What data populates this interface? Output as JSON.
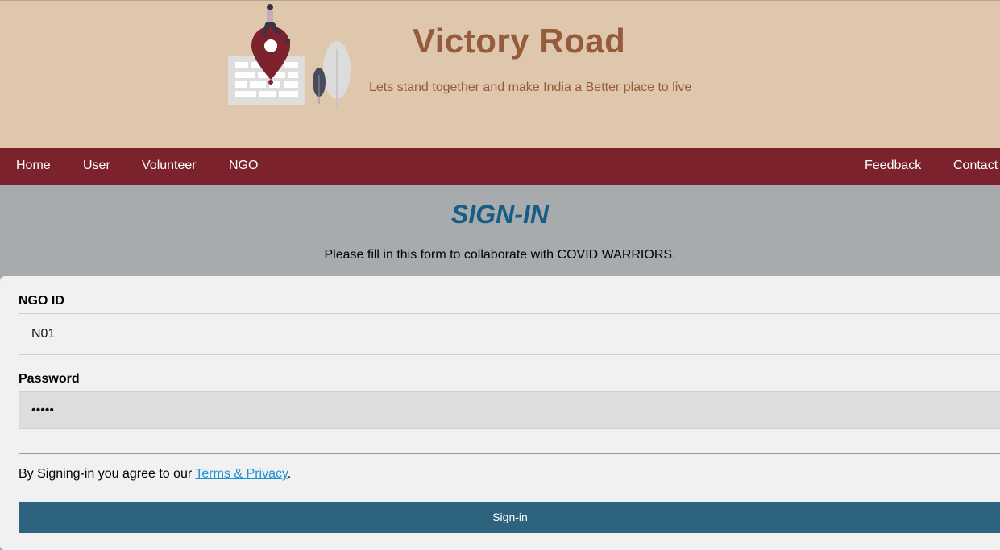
{
  "header": {
    "title": "Victory Road",
    "tagline": "Lets stand together and make India a Better place to live",
    "illustration_icon": "map-pin-with-woman-and-plants-illustration"
  },
  "nav": {
    "left_items": [
      "Home",
      "User",
      "Volunteer",
      "NGO"
    ],
    "right_items": [
      "Feedback",
      "Contact"
    ]
  },
  "signin": {
    "title": "SIGN-IN",
    "subtitle": "Please fill in this form to collaborate with COVID WARRIORS."
  },
  "form": {
    "ngo_id_label": "NGO ID",
    "ngo_id_value": "N01",
    "password_label": "Password",
    "password_value": "•••••",
    "agree_prefix": "By Signing-in you agree to our ",
    "terms_link": "Terms & Privacy",
    "agree_suffix": ".",
    "submit_label": "Sign-in"
  },
  "colors": {
    "header_bg": "#dfc7ad",
    "brand_brown": "#955b3a",
    "nav_bg": "#7b222c",
    "title_blue": "#165c84",
    "button_bg": "#2d637f",
    "link_blue": "#1f8fd6"
  }
}
